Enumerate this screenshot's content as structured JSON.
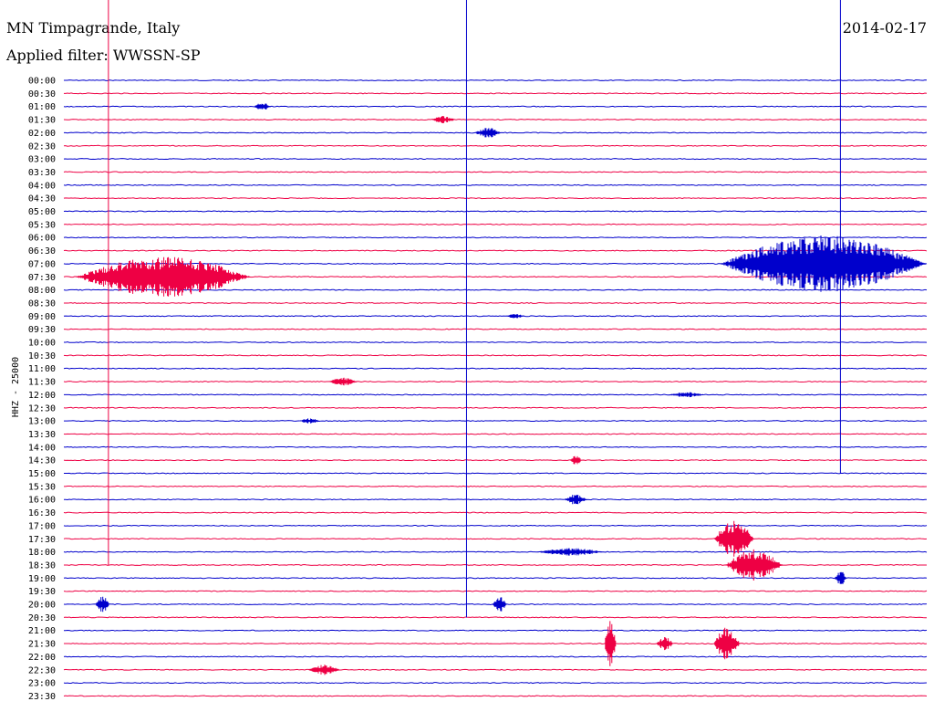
{
  "header": {
    "station": "MN Timpagrande, Italy",
    "date": "2014-02-17",
    "filter": "Applied filter: WWSSN-SP",
    "channel_label": "HHZ - 25000"
  },
  "colors": {
    "odd_trace": "#0000cc",
    "even_trace": "#ee0044",
    "background": "#ffffff"
  },
  "chart_data": {
    "type": "line",
    "title": "MN Timpagrande, Italy",
    "subtitle": "Applied filter: WWSSN-SP",
    "date": "2014-02-17",
    "ylabel": "HHZ - 25000",
    "x_unit": "minutes",
    "xlim": [
      0,
      30
    ],
    "rows": [
      "00:00",
      "00:30",
      "01:00",
      "01:30",
      "02:00",
      "02:30",
      "03:00",
      "03:30",
      "04:00",
      "04:30",
      "05:00",
      "05:30",
      "06:00",
      "06:30",
      "07:00",
      "07:30",
      "08:00",
      "08:30",
      "09:00",
      "09:30",
      "10:00",
      "10:30",
      "11:00",
      "11:30",
      "12:00",
      "12:30",
      "13:00",
      "13:30",
      "14:00",
      "14:30",
      "15:00",
      "15:30",
      "16:00",
      "16:30",
      "17:00",
      "17:30",
      "18:00",
      "18:30",
      "19:00",
      "19:30",
      "20:00",
      "20:30",
      "21:00",
      "21:30",
      "22:00",
      "22:30",
      "23:00",
      "23:30"
    ],
    "events": [
      {
        "row": "07:30",
        "start": 0.4,
        "end": 6.5,
        "amp": 1.6
      },
      {
        "row": "07:00",
        "start": 22.8,
        "end": 31.0,
        "amp": 2.2
      },
      {
        "row": "01:30",
        "start": 12.8,
        "end": 13.6,
        "amp": 0.3
      },
      {
        "row": "02:00",
        "start": 14.3,
        "end": 15.2,
        "amp": 0.4
      },
      {
        "row": "01:00",
        "start": 6.6,
        "end": 7.2,
        "amp": 0.3
      },
      {
        "row": "17:30",
        "start": 22.6,
        "end": 24.0,
        "amp": 1.4
      },
      {
        "row": "18:30",
        "start": 23.0,
        "end": 25.0,
        "amp": 1.2
      },
      {
        "row": "19:00",
        "start": 26.8,
        "end": 27.2,
        "amp": 0.6
      },
      {
        "row": "20:00",
        "start": 14.9,
        "end": 15.4,
        "amp": 0.6
      },
      {
        "row": "21:30",
        "start": 18.8,
        "end": 19.2,
        "amp": 1.8
      },
      {
        "row": "21:30",
        "start": 20.6,
        "end": 21.2,
        "amp": 0.5
      },
      {
        "row": "21:30",
        "start": 22.6,
        "end": 23.5,
        "amp": 1.3
      },
      {
        "row": "22:30",
        "start": 8.5,
        "end": 9.6,
        "amp": 0.4
      },
      {
        "row": "11:30",
        "start": 9.2,
        "end": 10.2,
        "amp": 0.3
      },
      {
        "row": "16:00",
        "start": 17.4,
        "end": 18.2,
        "amp": 0.4
      },
      {
        "row": "18:00",
        "start": 16.4,
        "end": 18.8,
        "amp": 0.3
      },
      {
        "row": "20:00",
        "start": 1.1,
        "end": 1.6,
        "amp": 0.6
      },
      {
        "row": "13:00",
        "start": 8.2,
        "end": 8.9,
        "amp": 0.2
      },
      {
        "row": "12:00",
        "start": 21.0,
        "end": 22.3,
        "amp": 0.2
      },
      {
        "row": "14:30",
        "start": 17.6,
        "end": 18.0,
        "amp": 0.4
      },
      {
        "row": "09:00",
        "start": 15.4,
        "end": 16.0,
        "amp": 0.2
      }
    ],
    "long_spikes": [
      {
        "start_row": "00:00",
        "end_row": "18:30",
        "x": 1.55
      },
      {
        "start_row": "00:00",
        "end_row": "20:30",
        "x": 14.0
      },
      {
        "start_row": "00:00",
        "end_row": "15:00",
        "x": 27.0
      }
    ]
  }
}
